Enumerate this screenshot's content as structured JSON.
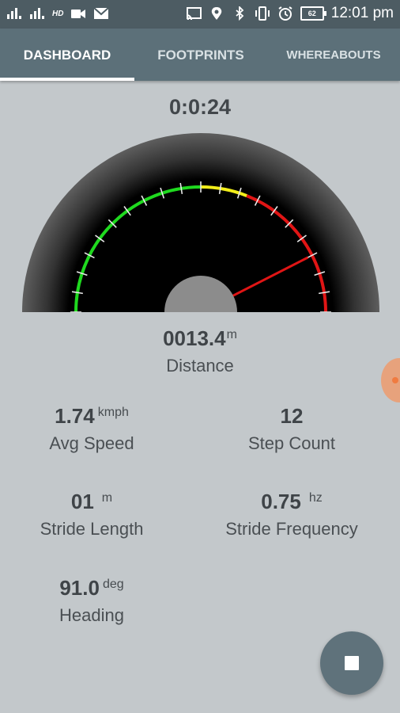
{
  "status_bar": {
    "hd_label": "HD",
    "battery_level": "62",
    "time": "12:01 pm",
    "left_icons": [
      "signal-icon",
      "signal-icon",
      "hd-icon",
      "video-icon",
      "mail-icon"
    ],
    "right_icons": [
      "cast-icon",
      "location-icon",
      "bluetooth-icon",
      "vibrate-icon",
      "alarm-icon",
      "battery-icon"
    ]
  },
  "tabs": [
    {
      "label": "DASHBOARD",
      "active": true
    },
    {
      "label": "FOOTPRINTS",
      "active": false
    },
    {
      "label": "WHEREABOUTS",
      "active": false
    }
  ],
  "timer": "0:0:24",
  "gauge": {
    "needle_fraction": 0.85,
    "zones": [
      {
        "color": "#1fd91f",
        "from": 0.0,
        "to": 0.5
      },
      {
        "color": "#f2ee1a",
        "from": 0.5,
        "to": 0.62
      },
      {
        "color": "#e01515",
        "from": 0.62,
        "to": 1.0
      }
    ],
    "needle_color": "#e01515",
    "tick_count": 21
  },
  "distance": {
    "value": "0013.4",
    "unit": "m",
    "label": "Distance"
  },
  "stats": {
    "avg_speed": {
      "value": "1.74",
      "unit": "kmph",
      "label": "Avg Speed"
    },
    "step_count": {
      "value": "12",
      "unit": "",
      "label": "Step Count"
    },
    "stride_length": {
      "value": "01",
      "unit": "m",
      "label": "Stride Length"
    },
    "stride_frequency": {
      "value": "0.75",
      "unit": "hz",
      "label": "Stride Frequency"
    },
    "heading": {
      "value": "91.0",
      "unit": "deg",
      "label": "Heading"
    }
  },
  "fab": {
    "icon": "stop-icon"
  }
}
